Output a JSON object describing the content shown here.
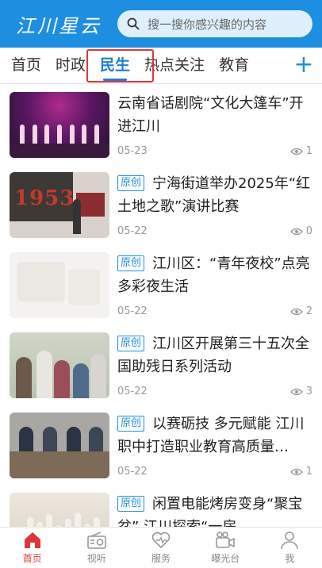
{
  "header": {
    "logo": "江川星云",
    "search_placeholder": "搜一搜你感兴趣的内容"
  },
  "tabs": [
    {
      "label": "首页"
    },
    {
      "label": "时政"
    },
    {
      "label": "民生",
      "active": true
    },
    {
      "label": "热点关注"
    },
    {
      "label": "教育"
    }
  ],
  "news": [
    {
      "title": "云南省话剧院“文化大篷车”开进江川",
      "badge": "",
      "date": "05-23",
      "views": "1"
    },
    {
      "title": "宁海街道举办2025年“红土地之歌”演讲比赛",
      "badge": "原创",
      "date": "05-22",
      "views": "0"
    },
    {
      "title": "江川区：“青年夜校”点亮多彩夜生活",
      "badge": "原创",
      "date": "05-22",
      "views": "2"
    },
    {
      "title": "江川区开展第三十五次全国助残日系列活动",
      "badge": "原创",
      "date": "05-22",
      "views": "3"
    },
    {
      "title": "以赛砺技 多元赋能 江川职中打造职业教育高质量…",
      "badge": "原创",
      "date": "05-22",
      "views": "1"
    },
    {
      "title": "闲置电能烤房变身“聚宝盆” 江川探索“一房…",
      "badge": "原创",
      "date": "",
      "views": ""
    }
  ],
  "thumb_text": {
    "year": "1953"
  },
  "bottom_nav": [
    {
      "label": "首页",
      "icon": "home-icon",
      "active": true
    },
    {
      "label": "视听",
      "icon": "radio-icon"
    },
    {
      "label": "服务",
      "icon": "service-heart-icon"
    },
    {
      "label": "曝光台",
      "icon": "camera-icon"
    },
    {
      "label": "我",
      "icon": "user-icon"
    }
  ],
  "colors": {
    "brand": "#1e8fe0",
    "active_nav": "#e0353a",
    "highlight": "#e0353a"
  }
}
